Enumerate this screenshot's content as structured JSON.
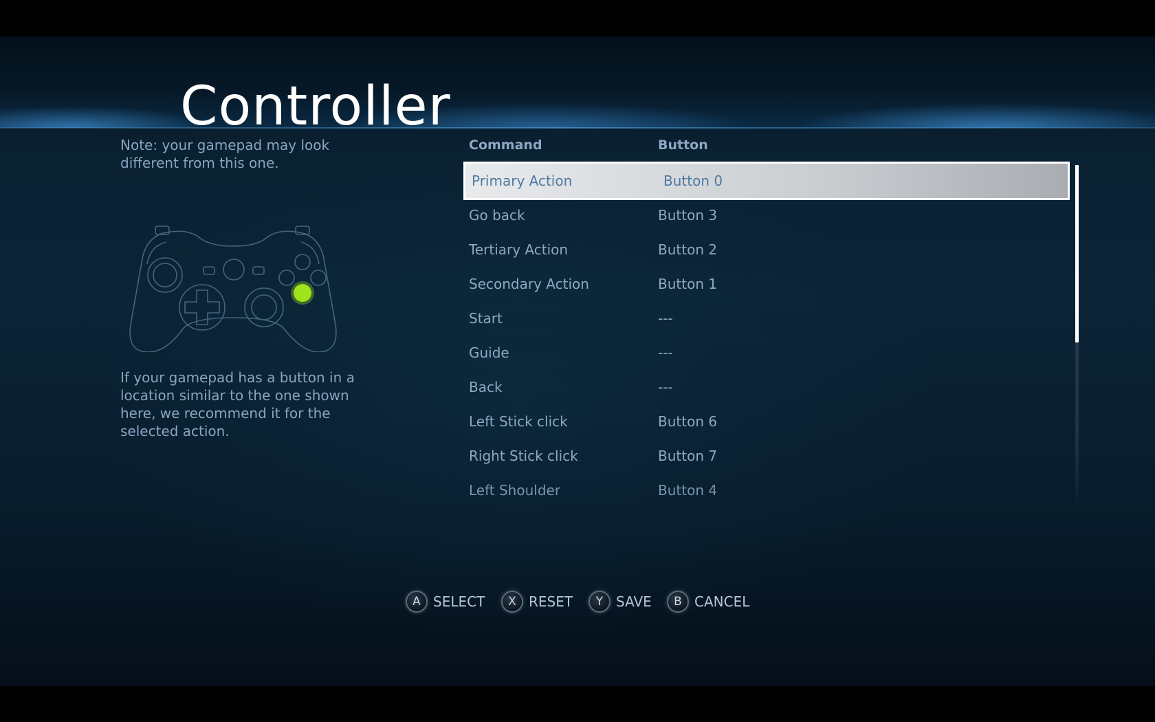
{
  "header": {
    "title": "Controller"
  },
  "left_panel": {
    "note_top": "Note: your gamepad may look different from this one.",
    "note_bottom": "If your gamepad has a button in a location similar to the one shown here, we recommend it for the selected action.",
    "highlight_color": "#9ee31b"
  },
  "table": {
    "headers": {
      "command": "Command",
      "button": "Button"
    },
    "rows": [
      {
        "command": "Primary Action",
        "button": "Button 0",
        "selected": true
      },
      {
        "command": "Go back",
        "button": "Button 3"
      },
      {
        "command": "Tertiary Action",
        "button": "Button 2"
      },
      {
        "command": "Secondary Action",
        "button": "Button 1"
      },
      {
        "command": "Start",
        "button": "---"
      },
      {
        "command": "Guide",
        "button": "---"
      },
      {
        "command": "Back",
        "button": "---"
      },
      {
        "command": "Left Stick click",
        "button": "Button 6"
      },
      {
        "command": "Right Stick click",
        "button": "Button 7"
      },
      {
        "command": "Left Shoulder",
        "button": "Button 4"
      }
    ]
  },
  "footer": {
    "hints": [
      {
        "glyph": "A",
        "label": "SELECT"
      },
      {
        "glyph": "X",
        "label": "RESET"
      },
      {
        "glyph": "Y",
        "label": "SAVE"
      },
      {
        "glyph": "B",
        "label": "CANCEL"
      }
    ]
  }
}
